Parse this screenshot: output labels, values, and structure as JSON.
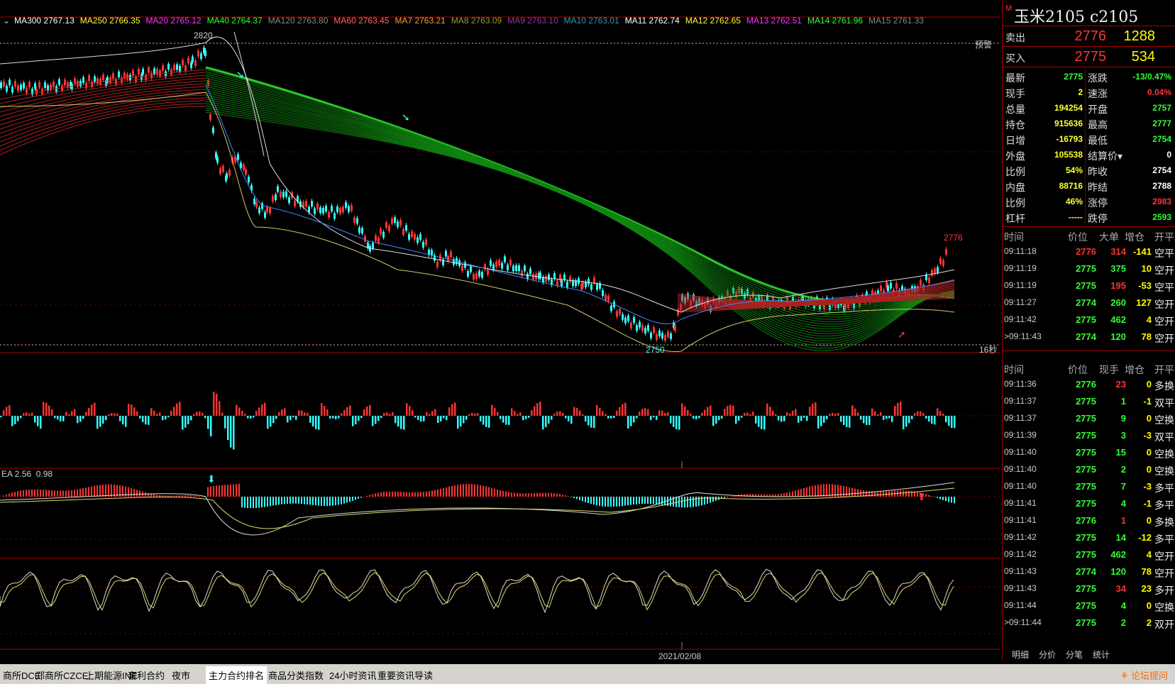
{
  "ma_indicators": [
    {
      "label": "MA300 2767.13",
      "color": "#ffffff"
    },
    {
      "label": "MA250 2766.35",
      "color": "#ffff33"
    },
    {
      "label": "MA20 2765.12",
      "color": "#ff33ff"
    },
    {
      "label": "MA40 2764.37",
      "color": "#33ff33"
    },
    {
      "label": "MA120 2763.80",
      "color": "#888888"
    },
    {
      "label": "MA60 2763.45",
      "color": "#ff6666"
    },
    {
      "label": "MA7 2763.21",
      "color": "#ff9933"
    },
    {
      "label": "MA8 2763.09",
      "color": "#999933"
    },
    {
      "label": "MA9 2763.10",
      "color": "#993399"
    },
    {
      "label": "MA10 2763.01",
      "color": "#3399aa"
    },
    {
      "label": "MA11 2762.74",
      "color": "#ffffff"
    },
    {
      "label": "MA12 2762.65",
      "color": "#ffff33"
    },
    {
      "label": "MA13 2762.51",
      "color": "#ff33ff"
    },
    {
      "label": "MA14 2761.96",
      "color": "#33ff33"
    },
    {
      "label": "MA15 2761.33",
      "color": "#888888"
    }
  ],
  "chart": {
    "high_label": "2820",
    "low_label": "2750",
    "last_label": "2776",
    "warning_label": "预警",
    "countdown_label": "16秒",
    "macd_label": "EA 2.56",
    "macd_value": "0.98",
    "date_label": "2021/02/08"
  },
  "symbol": {
    "marker": "M",
    "name": "玉米2105  c2105"
  },
  "orderbook": {
    "ask": {
      "label": "卖出",
      "price": "2776",
      "vol": "1288"
    },
    "bid": {
      "label": "买入",
      "price": "2775",
      "vol": "534"
    }
  },
  "quote": [
    {
      "l1": "最新",
      "v1": "2775",
      "c1": "#33ff33",
      "l2": "涨跌",
      "v2": "-13/0.47%",
      "c2": "#33ff33"
    },
    {
      "l1": "现手",
      "v1": "2",
      "c1": "#ffff33",
      "l2": "速涨",
      "v2": "0.04%",
      "c2": "#ff3333"
    },
    {
      "l1": "总量",
      "v1": "194254",
      "c1": "#ffff33",
      "l2": "开盘",
      "v2": "2757",
      "c2": "#33ff33"
    },
    {
      "l1": "持仓",
      "v1": "915636",
      "c1": "#ffff33",
      "l2": "最高",
      "v2": "2777",
      "c2": "#33ff33"
    },
    {
      "l1": "日增",
      "v1": "-16793",
      "c1": "#ffff33",
      "l2": "最低",
      "v2": "2754",
      "c2": "#33ff33"
    },
    {
      "l1": "外盘",
      "v1": "105538",
      "c1": "#ffff33",
      "l2": "结算价▾",
      "v2": "0",
      "c2": "#ffffff"
    },
    {
      "l1": "比例",
      "v1": "54%",
      "c1": "#ffff33",
      "l2": "昨收",
      "v2": "2754",
      "c2": "#ffffff"
    },
    {
      "l1": "内盘",
      "v1": "88716",
      "c1": "#ffff33",
      "l2": "昨结",
      "v2": "2788",
      "c2": "#ffffff"
    },
    {
      "l1": "比例",
      "v1": "46%",
      "c1": "#ffff33",
      "l2": "涨停",
      "v2": "2983",
      "c2": "#ff3333"
    },
    {
      "l1": "杠杆",
      "v1": "-----",
      "c1": "#ffff33",
      "l2": "跌停",
      "v2": "2593",
      "c2": "#33ff33"
    }
  ],
  "ticks1_header": [
    "时间",
    "价位",
    "大单",
    "增仓",
    "开平"
  ],
  "ticks1": [
    {
      "t": "09:11:18",
      "p": "2776",
      "pc": "#ff3333",
      "q": "314",
      "qc": "#ff3333",
      "oi": "-141",
      "ty": "空平"
    },
    {
      "t": "09:11:19",
      "p": "2775",
      "pc": "#33ff33",
      "q": "375",
      "qc": "#33ff33",
      "oi": "10",
      "ty": "空开"
    },
    {
      "t": "09:11:19",
      "p": "2775",
      "pc": "#33ff33",
      "q": "195",
      "qc": "#ff3333",
      "oi": "-53",
      "ty": "空平"
    },
    {
      "t": "09:11:27",
      "p": "2774",
      "pc": "#33ff33",
      "q": "260",
      "qc": "#33ff33",
      "oi": "127",
      "ty": "空开"
    },
    {
      "t": "09:11:42",
      "p": "2775",
      "pc": "#33ff33",
      "q": "462",
      "qc": "#33ff33",
      "oi": "4",
      "ty": "空开"
    },
    {
      "t": ">09:11:43",
      "p": "2774",
      "pc": "#33ff33",
      "q": "120",
      "qc": "#33ff33",
      "oi": "78",
      "ty": "空开"
    }
  ],
  "ticks2_header": [
    "时间",
    "价位",
    "现手",
    "增仓",
    "开平"
  ],
  "ticks2": [
    {
      "t": "09:11:36",
      "p": "2776",
      "pc": "#33ff33",
      "q": "23",
      "qc": "#ff3333",
      "oi": "0",
      "ty": "多换"
    },
    {
      "t": "09:11:37",
      "p": "2775",
      "pc": "#33ff33",
      "q": "1",
      "qc": "#33ff33",
      "oi": "-1",
      "ty": "双平"
    },
    {
      "t": "09:11:37",
      "p": "2775",
      "pc": "#33ff33",
      "q": "9",
      "qc": "#33ff33",
      "oi": "0",
      "ty": "空换"
    },
    {
      "t": "09:11:39",
      "p": "2775",
      "pc": "#33ff33",
      "q": "3",
      "qc": "#33ff33",
      "oi": "-3",
      "ty": "双平"
    },
    {
      "t": "09:11:40",
      "p": "2775",
      "pc": "#33ff33",
      "q": "15",
      "qc": "#33ff33",
      "oi": "0",
      "ty": "空换"
    },
    {
      "t": "09:11:40",
      "p": "2775",
      "pc": "#33ff33",
      "q": "2",
      "qc": "#33ff33",
      "oi": "0",
      "ty": "空换"
    },
    {
      "t": "09:11:40",
      "p": "2775",
      "pc": "#33ff33",
      "q": "7",
      "qc": "#33ff33",
      "oi": "-3",
      "ty": "多平"
    },
    {
      "t": "09:11:41",
      "p": "2775",
      "pc": "#33ff33",
      "q": "4",
      "qc": "#33ff33",
      "oi": "-1",
      "ty": "多平"
    },
    {
      "t": "09:11:41",
      "p": "2776",
      "pc": "#33ff33",
      "q": "1",
      "qc": "#ff3333",
      "oi": "0",
      "ty": "多换"
    },
    {
      "t": "09:11:42",
      "p": "2775",
      "pc": "#33ff33",
      "q": "14",
      "qc": "#33ff33",
      "oi": "-12",
      "ty": "多平"
    },
    {
      "t": "09:11:42",
      "p": "2775",
      "pc": "#33ff33",
      "q": "462",
      "qc": "#33ff33",
      "oi": "4",
      "ty": "空开"
    },
    {
      "t": "09:11:43",
      "p": "2774",
      "pc": "#33ff33",
      "q": "120",
      "qc": "#33ff33",
      "oi": "78",
      "ty": "空开"
    },
    {
      "t": "09:11:43",
      "p": "2775",
      "pc": "#33ff33",
      "q": "34",
      "qc": "#ff3333",
      "oi": "23",
      "ty": "多开"
    },
    {
      "t": "09:11:44",
      "p": "2775",
      "pc": "#33ff33",
      "q": "4",
      "qc": "#33ff33",
      "oi": "0",
      "ty": "空换"
    },
    {
      "t": ">09:11:44",
      "p": "2775",
      "pc": "#33ff33",
      "q": "2",
      "qc": "#33ff33",
      "oi": "2",
      "ty": "双开"
    }
  ],
  "side_tabs": [
    "明细",
    "分价",
    "分笔",
    "统计"
  ],
  "bottom_tabs": [
    "商所DCE",
    "郑商所CZCE",
    "上期能源INE",
    "套利合约",
    "夜市",
    "主力合约排名",
    "商品分类指数",
    "24小时资讯",
    "重要资讯导读"
  ],
  "active_bottom_tab": "主力合约排名",
  "help_label": "论坛提问",
  "colors": {
    "up": "#ff3333",
    "down": "#33ffff",
    "green": "#33ff33",
    "border": "#aa0000",
    "yellow": "#ffff33"
  }
}
